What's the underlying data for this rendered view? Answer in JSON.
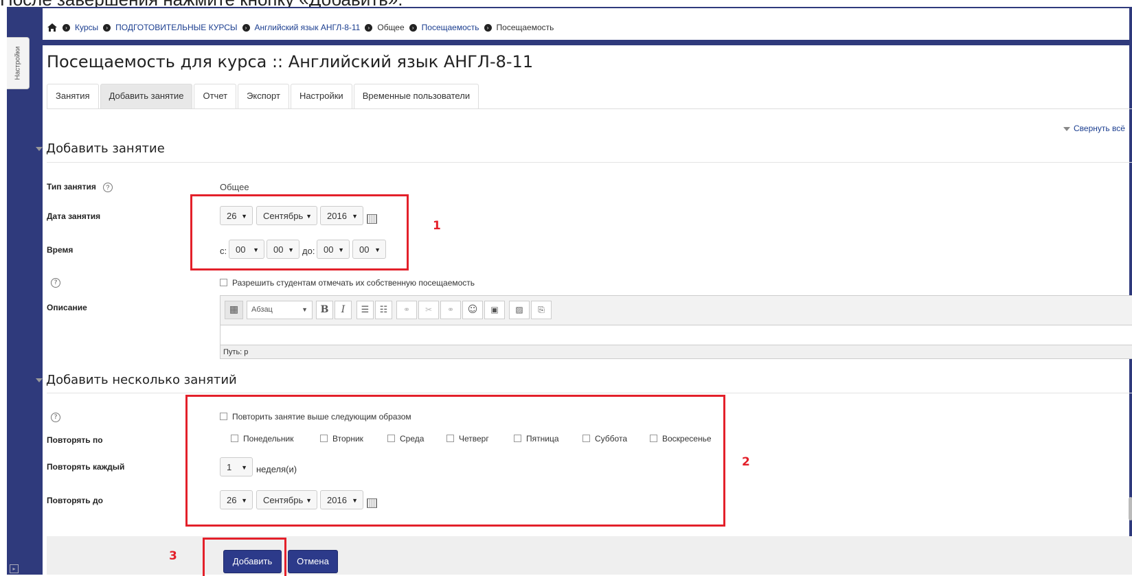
{
  "top_caption": "После завершения нажмите кнопку «Добавить».",
  "settings_tab": "Настройки",
  "breadcrumb": {
    "items": [
      "Курсы",
      "ПОДГОТОВИТЕЛЬНЫЕ КУРСЫ",
      "Английский язык АНГЛ-8-11",
      "Общее",
      "Посещаемость",
      "Посещаемость"
    ]
  },
  "page_title": "Посещаемость для курса :: Английский язык АНГЛ-8-11",
  "tabs": [
    "Занятия",
    "Добавить занятие",
    "Отчет",
    "Экспорт",
    "Настройки",
    "Временные пользователи"
  ],
  "active_tab": "Добавить занятие",
  "collapse_all": "Свернуть всё",
  "section1": {
    "title": "Добавить занятие",
    "session_type_label": "Тип занятия",
    "session_type_value": "Общее",
    "date_label": "Дата занятия",
    "date_day": "26",
    "date_month": "Сентябрь",
    "date_year": "2016",
    "time_label": "Время",
    "time_from_prefix": "с:",
    "time_from_h": "00",
    "time_from_m": "00",
    "time_to_prefix": "до:",
    "time_to_h": "00",
    "time_to_m": "00",
    "self_mark_label": "Разрешить студентам отмечать их собственную посещаемость",
    "description_label": "Описание",
    "editor_format": "Абзац",
    "editor_path": "Путь: p"
  },
  "section2": {
    "title": "Добавить несколько занятий",
    "repeat_label": "Повторить занятие выше следующим образом",
    "repeat_on_label": "Повторять по",
    "weekdays": [
      "Понедельник",
      "Вторник",
      "Среда",
      "Четверг",
      "Пятница",
      "Суббота",
      "Воскресенье"
    ],
    "repeat_every_label": "Повторять каждый",
    "repeat_every_value": "1",
    "repeat_every_unit": "неделя(и)",
    "repeat_until_label": "Повторять до",
    "until_day": "26",
    "until_month": "Сентябрь",
    "until_year": "2016"
  },
  "buttons": {
    "add": "Добавить",
    "cancel": "Отмена"
  },
  "annotations": [
    "1",
    "2",
    "3"
  ],
  "colors": {
    "navy": "#2f3a7c",
    "annotation_red": "#e3202a",
    "link": "#1a3d8f",
    "primary_button": "#2c3a8a"
  }
}
